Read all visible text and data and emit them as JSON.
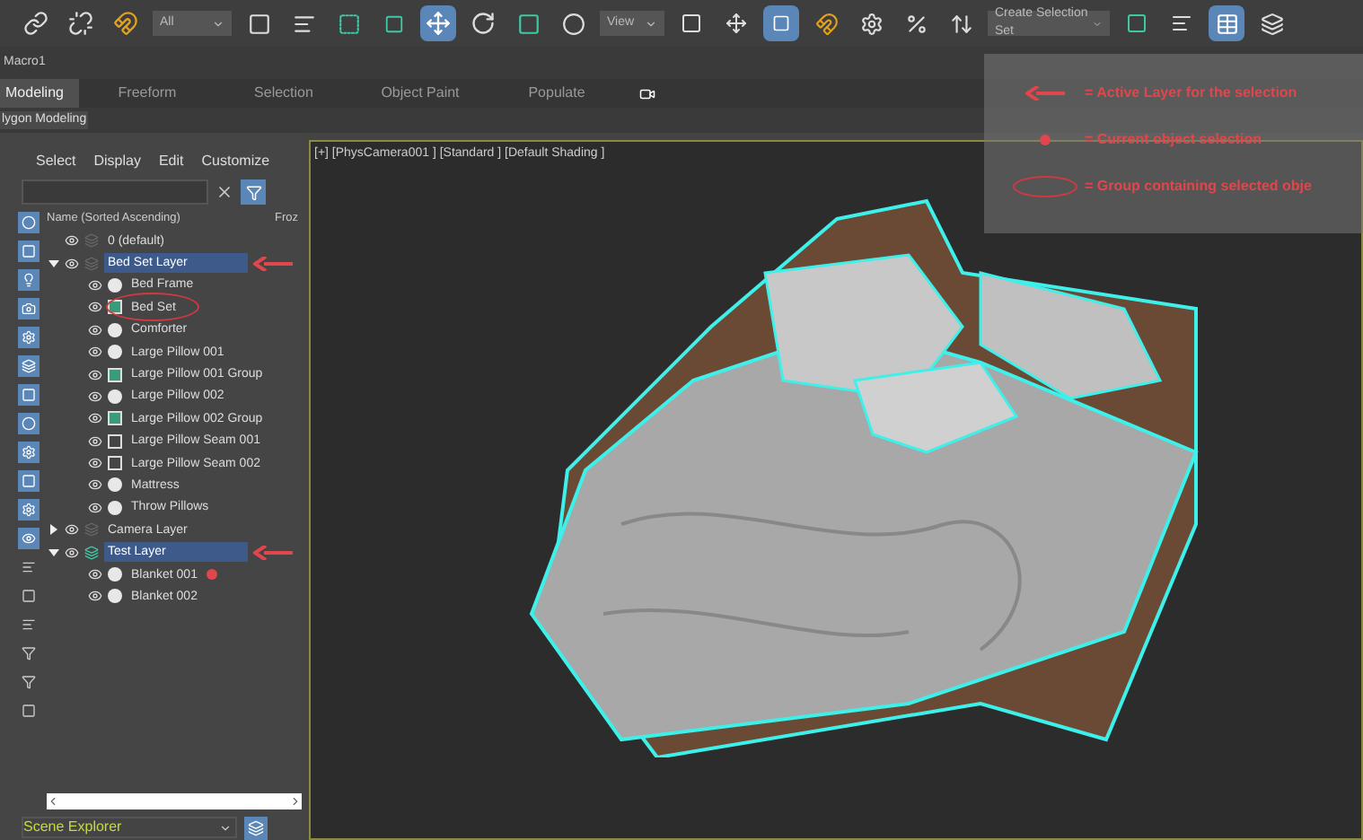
{
  "toolbar": {
    "selection_filter": "All",
    "coordinate_system": "View",
    "selection_set": "Create Selection Set"
  },
  "macro_label": "Macro1",
  "ribbon_tabs": [
    {
      "label": "Modeling",
      "selected": true
    },
    {
      "label": "Freeform",
      "selected": false
    },
    {
      "label": "Selection",
      "selected": false
    },
    {
      "label": "Object Paint",
      "selected": false
    },
    {
      "label": "Populate",
      "selected": false
    }
  ],
  "ribbon_panel": "lygon Modeling",
  "explorer": {
    "menu": [
      "Select",
      "Display",
      "Edit",
      "Customize"
    ],
    "columns": [
      "Name (Sorted Ascending)",
      "Froz"
    ],
    "tree": [
      {
        "label": "0 (default)",
        "kind": "layer",
        "selected": false,
        "active": false,
        "flagged": false
      },
      {
        "label": "Bed Set Layer",
        "kind": "layer",
        "selected": true,
        "expanded": true,
        "active": false,
        "flagged": true,
        "children": [
          {
            "label": "Bed Frame",
            "kind": "object",
            "circled": false,
            "dotted": false
          },
          {
            "label": "Bed Set",
            "kind": "group",
            "circled": true,
            "dotted": false
          },
          {
            "label": "Comforter",
            "kind": "object",
            "circled": false,
            "dotted": false
          },
          {
            "label": "Large Pillow 001",
            "kind": "object",
            "circled": false,
            "dotted": false
          },
          {
            "label": "Large Pillow 001 Group",
            "kind": "group",
            "circled": false,
            "dotted": false
          },
          {
            "label": "Large Pillow 002",
            "kind": "object",
            "circled": false,
            "dotted": false
          },
          {
            "label": "Large Pillow 002 Group",
            "kind": "group",
            "circled": false,
            "dotted": false
          },
          {
            "label": "Large Pillow Seam 001",
            "kind": "shape",
            "circled": false,
            "dotted": false
          },
          {
            "label": "Large Pillow Seam 002",
            "kind": "shape",
            "circled": false,
            "dotted": false
          },
          {
            "label": "Mattress",
            "kind": "object",
            "circled": false,
            "dotted": false
          },
          {
            "label": "Throw Pillows",
            "kind": "object",
            "circled": false,
            "dotted": false
          }
        ]
      },
      {
        "label": "Camera Layer",
        "kind": "layer",
        "selected": false,
        "expanded": false,
        "active": false,
        "flagged": false
      },
      {
        "label": "Test Layer",
        "kind": "layer",
        "selected": true,
        "expanded": true,
        "active": true,
        "flagged": true,
        "children": [
          {
            "label": "Blanket 001",
            "kind": "object",
            "circled": false,
            "dotted": true
          },
          {
            "label": "Blanket 002",
            "kind": "object",
            "circled": false,
            "dotted": false
          }
        ]
      }
    ],
    "mode": "Scene Explorer"
  },
  "viewport": {
    "label": "[+] [PhysCamera001 ] [Standard ] [Default Shading ]"
  },
  "legend": [
    {
      "kind": "arrow",
      "text": "= Active Layer for the selection"
    },
    {
      "kind": "dot",
      "text": "= Current object selection"
    },
    {
      "kind": "ellipse",
      "text": "= Group containing selected obje"
    }
  ]
}
